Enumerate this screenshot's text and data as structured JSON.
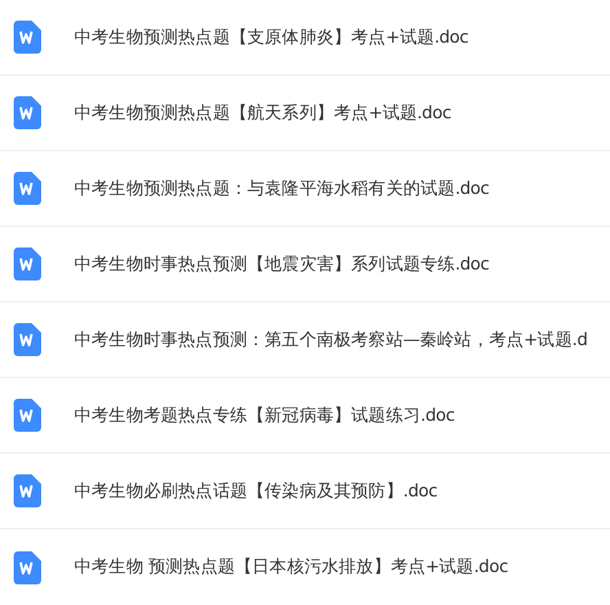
{
  "files": [
    {
      "name": "中考生物预测热点题【支原体肺炎】考点+试题.doc"
    },
    {
      "name": "中考生物预测热点题【航天系列】考点+试题.doc"
    },
    {
      "name": "中考生物预测热点题：与袁隆平海水稻有关的试题.doc"
    },
    {
      "name": "中考生物时事热点预测【地震灾害】系列试题专练.doc"
    },
    {
      "name": "中考生物时事热点预测：第五个南极考察站—秦岭站，考点+试题.d"
    },
    {
      "name": "中考生物考题热点专练【新冠病毒】试题练习.doc"
    },
    {
      "name": "中考生物必刷热点话题【传染病及其预防】.doc"
    },
    {
      "name": "中考生物 预测热点题【日本核污水排放】考点+试题.doc"
    }
  ]
}
